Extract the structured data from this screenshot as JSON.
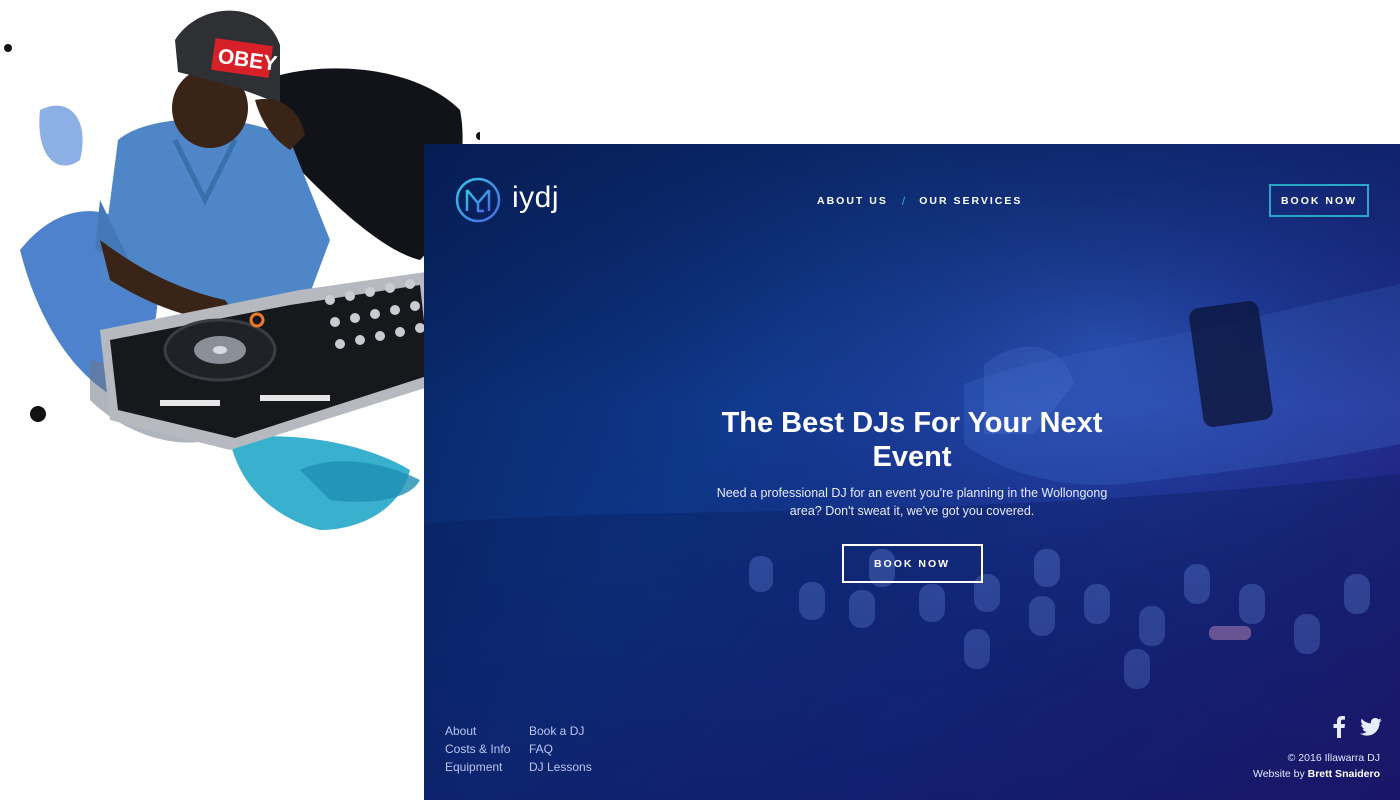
{
  "promo": {
    "cap_text": "OBEY"
  },
  "site": {
    "logo": {
      "text": "iydj",
      "icon": "iydj-logo-icon"
    },
    "nav": {
      "items": [
        {
          "label": "ABOUT US"
        },
        {
          "label": "OUR SERVICES"
        }
      ],
      "separator": "/"
    },
    "header_button": "BOOK NOW",
    "hero": {
      "title": "The Best DJs For Your Next Event",
      "subtitle": "Need a professional DJ for an event you're planning in the Wollongong area? Don't sweat it, we've got you covered.",
      "button": "BOOK NOW"
    },
    "footer": {
      "links": [
        {
          "label": "About"
        },
        {
          "label": "Book a DJ"
        },
        {
          "label": "Costs & Info"
        },
        {
          "label": "FAQ"
        },
        {
          "label": "Equipment"
        },
        {
          "label": "DJ Lessons"
        }
      ],
      "social": [
        {
          "icon": "facebook-icon"
        },
        {
          "icon": "twitter-icon"
        }
      ],
      "copyright": "© 2016 Illawarra DJ",
      "credit_prefix": "Website by",
      "credit_name": "Brett Snaidero"
    },
    "colors": {
      "accent": "#2aa6c6",
      "background_start": "#07205a",
      "background_end": "#2a1a7f"
    }
  }
}
